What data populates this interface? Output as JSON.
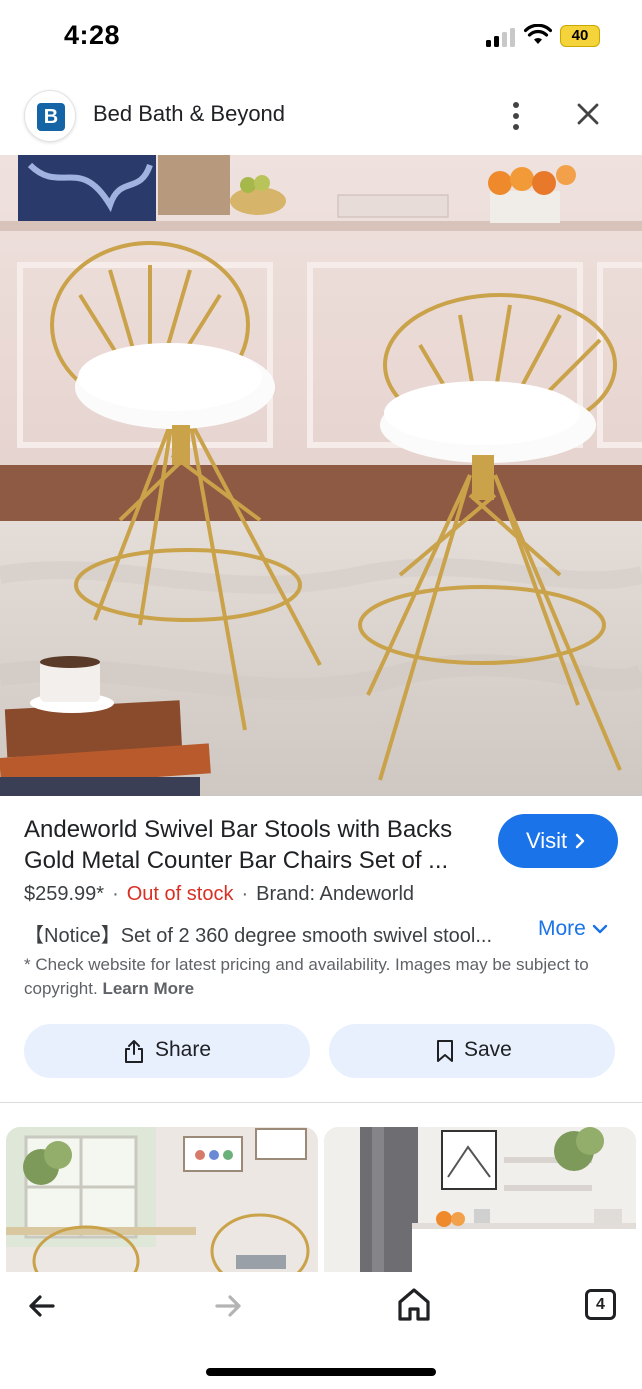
{
  "status_bar": {
    "time": "4:28",
    "battery": "40",
    "battery_color": "#f5d33a"
  },
  "header": {
    "site_logo_letter": "B",
    "site_name": "Bed Bath & Beyond",
    "menu_icon": "more-vert-icon",
    "close_icon": "close-icon"
  },
  "product": {
    "image_icon": "product-photo",
    "title_line1": "Andeworld Swivel Bar Stools with Backs",
    "title_line2": "Gold Metal Counter Bar Chairs Set of ...",
    "visit_label": "Visit",
    "price": "$259.99*",
    "stock": "Out of stock",
    "brand": "Brand: Andeworld",
    "notice": "【Notice】Set of 2 360 degree smooth swivel stool...",
    "more_label": "More",
    "disclaimer": "* Check website for latest pricing and availability. Images may be subject to copyright.",
    "learn_more": "Learn More",
    "share_label": "Share",
    "save_label": "Save"
  },
  "related_thumbnails": [
    {
      "icon": "related-product-photo"
    },
    {
      "icon": "related-product-photo"
    }
  ],
  "bottom_nav": {
    "back_icon": "arrow-back-icon",
    "forward_icon": "arrow-forward-icon",
    "home_icon": "home-icon",
    "tab_count": "4"
  },
  "colors": {
    "accent": "#1a73e8",
    "stock_red": "#d93025",
    "button_bg": "#e8f0fe"
  }
}
